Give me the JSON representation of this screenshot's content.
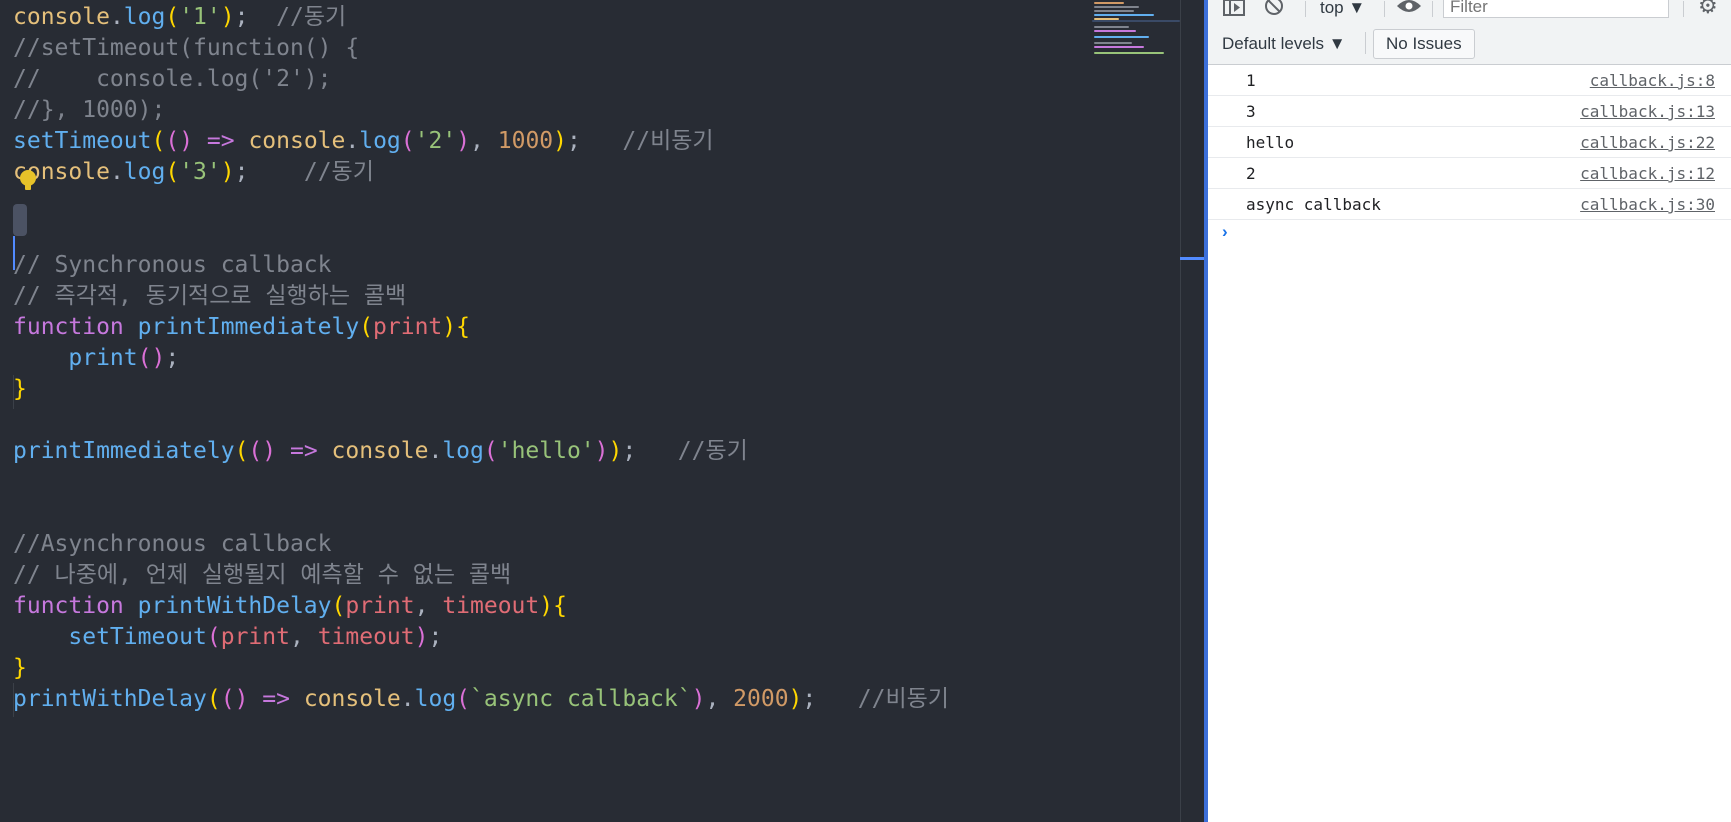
{
  "editor": {
    "lines": [
      {
        "tokens": [
          [
            "console",
            "t-obj"
          ],
          [
            ".",
            "t-pun"
          ],
          [
            "log",
            "t-fn"
          ],
          [
            "(",
            "t-b1"
          ],
          [
            "'1'",
            "t-str"
          ],
          [
            ")",
            "t-b1"
          ],
          [
            ";  ",
            "t-pun"
          ],
          [
            "//동기",
            "t-cm"
          ]
        ]
      },
      {
        "tokens": [
          [
            "//setTimeout(function() {",
            "t-cm"
          ]
        ]
      },
      {
        "tokens": [
          [
            "//    console.log('2');",
            "t-cm"
          ]
        ]
      },
      {
        "tokens": [
          [
            "//}, 1000);",
            "t-cm"
          ]
        ]
      },
      {
        "tokens": [
          [
            "setTimeout",
            "t-fn"
          ],
          [
            "(",
            "t-b1"
          ],
          [
            "()",
            "t-b2"
          ],
          [
            " => ",
            "t-op"
          ],
          [
            "console",
            "t-obj"
          ],
          [
            ".",
            "t-pun"
          ],
          [
            "log",
            "t-fn"
          ],
          [
            "(",
            "t-b2"
          ],
          [
            "'2'",
            "t-str"
          ],
          [
            ")",
            "t-b2"
          ],
          [
            ", ",
            "t-pun"
          ],
          [
            "1000",
            "t-num"
          ],
          [
            ")",
            "t-b1"
          ],
          [
            ";   ",
            "t-pun"
          ],
          [
            "//비동기",
            "t-cm"
          ]
        ]
      },
      {
        "tokens": [
          [
            "console",
            "t-obj"
          ],
          [
            ".",
            "t-pun"
          ],
          [
            "log",
            "t-fn"
          ],
          [
            "(",
            "t-b1"
          ],
          [
            "'3'",
            "t-str"
          ],
          [
            ")",
            "t-b1"
          ],
          [
            ";    ",
            "t-pun"
          ],
          [
            "//동기",
            "t-cm"
          ]
        ]
      },
      {
        "tokens": []
      },
      {
        "tokens": []
      },
      {
        "tokens": [
          [
            "// Synchronous callback",
            "t-cm"
          ]
        ]
      },
      {
        "tokens": [
          [
            "// 즉각적, 동기적으로 실행하는 콜백",
            "t-cm"
          ]
        ]
      },
      {
        "tokens": [
          [
            "function ",
            "t-kw"
          ],
          [
            "printImmediately",
            "t-fn"
          ],
          [
            "(",
            "t-b1"
          ],
          [
            "print",
            "t-par"
          ],
          [
            ")",
            "t-b1"
          ],
          [
            "{",
            "t-b1"
          ]
        ]
      },
      {
        "tokens": [
          [
            "    ",
            "t-plain"
          ],
          [
            "print",
            "t-fn"
          ],
          [
            "()",
            "t-b2"
          ],
          [
            ";",
            "t-pun"
          ]
        ]
      },
      {
        "tokens": [
          [
            "}",
            "t-b1"
          ]
        ]
      },
      {
        "tokens": []
      },
      {
        "tokens": [
          [
            "printImmediately",
            "t-fn"
          ],
          [
            "(",
            "t-b1"
          ],
          [
            "()",
            "t-b2"
          ],
          [
            " => ",
            "t-op"
          ],
          [
            "console",
            "t-obj"
          ],
          [
            ".",
            "t-pun"
          ],
          [
            "log",
            "t-fn"
          ],
          [
            "(",
            "t-b2"
          ],
          [
            "'hello'",
            "t-str"
          ],
          [
            ")",
            "t-b2"
          ],
          [
            ")",
            "t-b1"
          ],
          [
            ";   ",
            "t-pun"
          ],
          [
            "//동기",
            "t-cm"
          ]
        ]
      },
      {
        "tokens": []
      },
      {
        "tokens": []
      },
      {
        "tokens": [
          [
            "//Asynchronous callback",
            "t-cm"
          ]
        ]
      },
      {
        "tokens": [
          [
            "// 나중에, 언제 실행될지 예측할 수 없는 콜백",
            "t-cm"
          ]
        ]
      },
      {
        "tokens": [
          [
            "function ",
            "t-kw"
          ],
          [
            "printWithDelay",
            "t-fn"
          ],
          [
            "(",
            "t-b1"
          ],
          [
            "print",
            "t-par"
          ],
          [
            ", ",
            "t-pun"
          ],
          [
            "timeout",
            "t-par"
          ],
          [
            ")",
            "t-b1"
          ],
          [
            "{",
            "t-b1"
          ]
        ]
      },
      {
        "tokens": [
          [
            "    ",
            "t-plain"
          ],
          [
            "setTimeout",
            "t-fn"
          ],
          [
            "(",
            "t-b2"
          ],
          [
            "print",
            "t-par"
          ],
          [
            ", ",
            "t-pun"
          ],
          [
            "timeout",
            "t-par"
          ],
          [
            ")",
            "t-b2"
          ],
          [
            ";",
            "t-pun"
          ]
        ]
      },
      {
        "tokens": [
          [
            "}",
            "t-b1"
          ]
        ]
      },
      {
        "tokens": [
          [
            "printWithDelay",
            "t-fn"
          ],
          [
            "(",
            "t-b1"
          ],
          [
            "()",
            "t-b2"
          ],
          [
            " => ",
            "t-op"
          ],
          [
            "console",
            "t-obj"
          ],
          [
            ".",
            "t-pun"
          ],
          [
            "log",
            "t-fn"
          ],
          [
            "(",
            "t-b2"
          ],
          [
            "`async callback`",
            "t-str"
          ],
          [
            ")",
            "t-b2"
          ],
          [
            ", ",
            "t-pun"
          ],
          [
            "2000",
            "t-num"
          ],
          [
            ")",
            "t-b1"
          ],
          [
            ";   ",
            "t-pun"
          ],
          [
            "//비동기",
            "t-cm"
          ]
        ]
      }
    ]
  },
  "devtools": {
    "context": "top ▼",
    "filter_placeholder": "Filter",
    "levels": "Default levels ▼",
    "issues": "No Issues",
    "messages": [
      {
        "text": "1",
        "source": "callback.js:8"
      },
      {
        "text": "3",
        "source": "callback.js:13"
      },
      {
        "text": "hello",
        "source": "callback.js:22"
      },
      {
        "text": "2",
        "source": "callback.js:12"
      },
      {
        "text": "async callback",
        "source": "callback.js:30"
      }
    ],
    "prompt": "›",
    "icons": {
      "sidebar": "sidebar-toggle-icon",
      "clear": "clear-console-icon",
      "eye": "live-expression-icon",
      "gear": "gear-icon"
    }
  }
}
